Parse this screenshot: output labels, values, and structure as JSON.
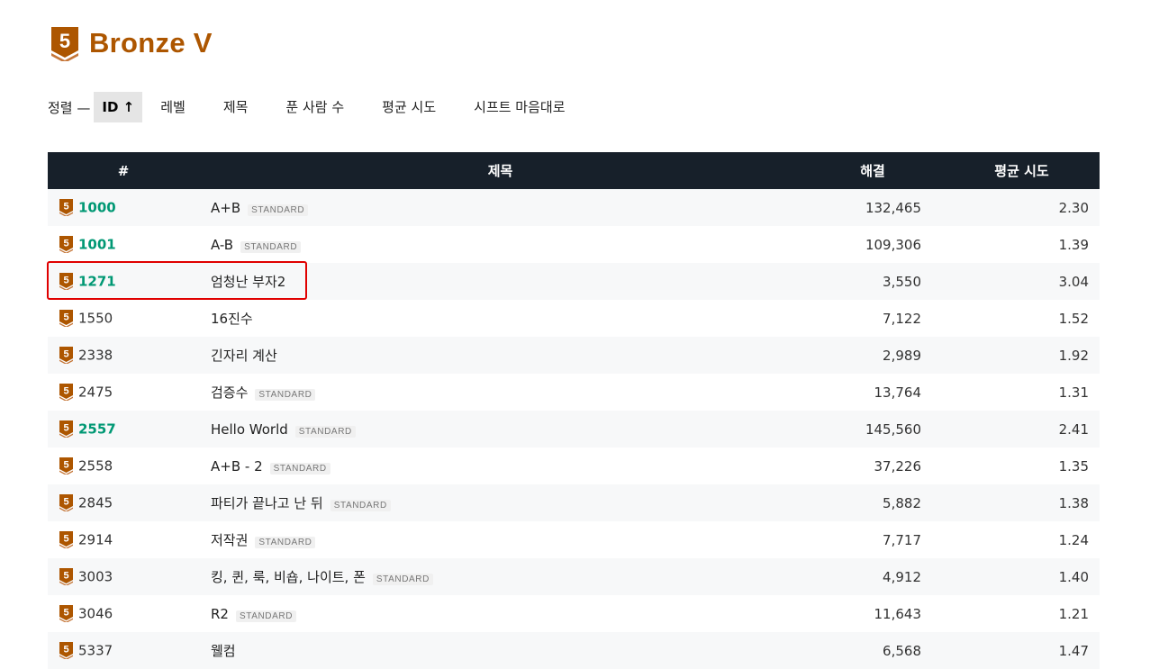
{
  "header": {
    "tier_number": "5",
    "tier_name": "Bronze V",
    "tier_color": "#ad5600"
  },
  "sort": {
    "label": "정렬 —",
    "options": [
      {
        "label": "ID ↑",
        "active": true
      },
      {
        "label": "레벨",
        "active": false
      },
      {
        "label": "제목",
        "active": false
      },
      {
        "label": "푼 사람 수",
        "active": false
      },
      {
        "label": "평균 시도",
        "active": false
      },
      {
        "label": "시프트 마음대로",
        "active": false
      }
    ]
  },
  "table": {
    "headers": {
      "id": "#",
      "title": "제목",
      "solved": "해결",
      "avg": "평균 시도"
    },
    "rows": [
      {
        "id": "1000",
        "solved_by_me": true,
        "title": "A+B",
        "tag": "STANDARD",
        "solved": "132,465",
        "avg": "2.30"
      },
      {
        "id": "1001",
        "solved_by_me": true,
        "title": "A-B",
        "tag": "STANDARD",
        "solved": "109,306",
        "avg": "1.39"
      },
      {
        "id": "1271",
        "solved_by_me": true,
        "title": "엄청난 부자2",
        "tag": "",
        "solved": "3,550",
        "avg": "3.04"
      },
      {
        "id": "1550",
        "solved_by_me": false,
        "title": "16진수",
        "tag": "",
        "solved": "7,122",
        "avg": "1.52"
      },
      {
        "id": "2338",
        "solved_by_me": false,
        "title": "긴자리 계산",
        "tag": "",
        "solved": "2,989",
        "avg": "1.92"
      },
      {
        "id": "2475",
        "solved_by_me": false,
        "title": "검증수",
        "tag": "STANDARD",
        "solved": "13,764",
        "avg": "1.31"
      },
      {
        "id": "2557",
        "solved_by_me": true,
        "title": "Hello World",
        "tag": "STANDARD",
        "solved": "145,560",
        "avg": "2.41"
      },
      {
        "id": "2558",
        "solved_by_me": false,
        "title": "A+B - 2",
        "tag": "STANDARD",
        "solved": "37,226",
        "avg": "1.35"
      },
      {
        "id": "2845",
        "solved_by_me": false,
        "title": "파티가 끝나고 난 뒤",
        "tag": "STANDARD",
        "solved": "5,882",
        "avg": "1.38"
      },
      {
        "id": "2914",
        "solved_by_me": false,
        "title": "저작권",
        "tag": "STANDARD",
        "solved": "7,717",
        "avg": "1.24"
      },
      {
        "id": "3003",
        "solved_by_me": false,
        "title": "킹, 퀸, 룩, 비숍, 나이트, 폰",
        "tag": "STANDARD",
        "solved": "4,912",
        "avg": "1.40"
      },
      {
        "id": "3046",
        "solved_by_me": false,
        "title": "R2",
        "tag": "STANDARD",
        "solved": "11,643",
        "avg": "1.21"
      },
      {
        "id": "5337",
        "solved_by_me": false,
        "title": "웰컴",
        "tag": "",
        "solved": "6,568",
        "avg": "1.47"
      }
    ]
  },
  "colors": {
    "solved_id": "#009874",
    "header_bg": "#17202a",
    "highlight": "#e00000"
  }
}
